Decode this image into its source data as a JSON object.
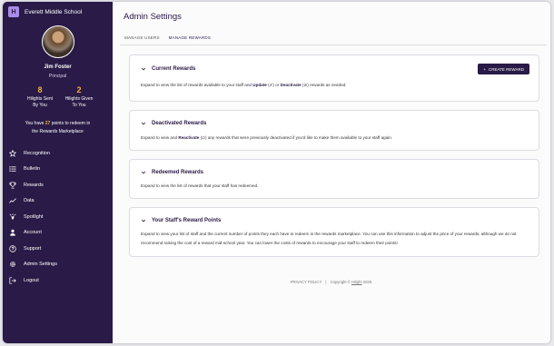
{
  "sidebar": {
    "school_name": "Everett Middle School",
    "logo_glyph": "H",
    "user": {
      "name": "Jim Foster",
      "role": "Principal"
    },
    "stats": [
      {
        "value": "8",
        "label_line1": "Hilights Sent",
        "label_line2": "By You"
      },
      {
        "value": "2",
        "label_line1": "Hilights Given",
        "label_line2": "To You"
      }
    ],
    "points": {
      "prefix": "You have ",
      "value": "27",
      "suffix": " points to redeem in",
      "line2": "the Rewards Marketplace"
    },
    "nav": [
      {
        "label": "Recognition",
        "icon": "star-icon"
      },
      {
        "label": "Bulletin",
        "icon": "list-icon"
      },
      {
        "label": "Rewards",
        "icon": "trophy-icon"
      },
      {
        "label": "Data",
        "icon": "chart-line-icon"
      },
      {
        "label": "Spotlight",
        "icon": "spotlight-icon"
      },
      {
        "label": "Account",
        "icon": "person-icon"
      },
      {
        "label": "Support",
        "icon": "help-icon"
      },
      {
        "label": "Admin Settings",
        "icon": "gear-icon"
      },
      {
        "label": "Logout",
        "icon": "logout-icon"
      }
    ]
  },
  "main": {
    "title": "Admin Settings",
    "tabs": [
      {
        "label": "MANAGE USERS",
        "active": false
      },
      {
        "label": "MANAGE REWARDS",
        "active": true
      }
    ],
    "create_button": "CREATE REWARD",
    "sections": {
      "current": {
        "title": "Current Rewards",
        "desc_a": "Expand to view the list of rewards available to your staff and ",
        "desc_update": "Update",
        "desc_b": " (✔) or ",
        "desc_deactivate": "Deactivate",
        "desc_c": " (⊘) rewards as needed."
      },
      "deactivated": {
        "title": "Deactivated Rewards",
        "desc_a": "Expand to view and ",
        "desc_reactivate": "Reactivate",
        "desc_b": " (⊙) any rewards that were previously deactivated if you'd like to make them available to your staff again."
      },
      "redeemed": {
        "title": "Redeemed Rewards",
        "desc": "Expand to view the list of rewards that your staff has redeemed."
      },
      "staff_points": {
        "title": "Your Staff's Reward Points",
        "desc": "Expand to view your list of staff and the current number of points they each have to redeem in the rewards marketplace. You can use this information to adjust the price of your rewards, although we do not recommend raising the cost of a reward mid-school year. You can lower the costs of rewards to encourage your staff to redeem their points!"
      }
    },
    "footer": {
      "privacy": "PRIVACY POLICY",
      "separator": "|",
      "copyright": "Copyright © ",
      "brand": "Hilight",
      "year": " 2025."
    }
  },
  "colors": {
    "sidebar_bg": "#291a47",
    "accent": "#f0b23c",
    "primary": "#291a47"
  }
}
